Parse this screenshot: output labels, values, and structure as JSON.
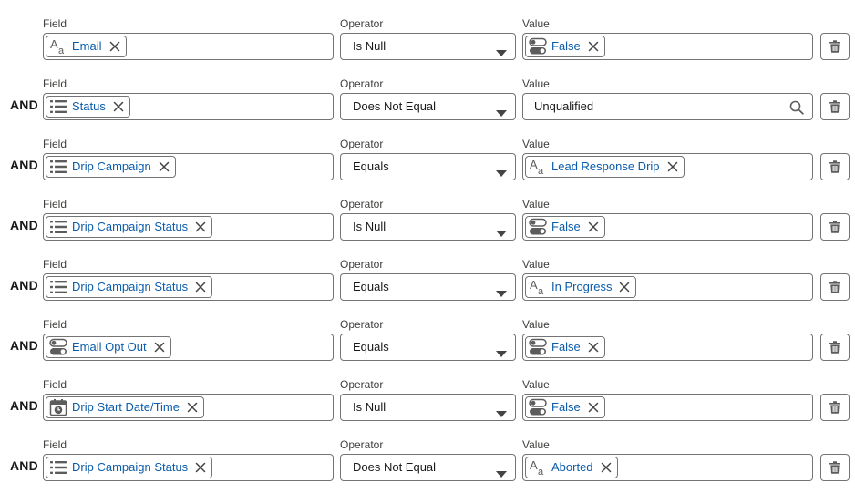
{
  "labels": {
    "field": "Field",
    "operator": "Operator",
    "value": "Value"
  },
  "colors": {
    "pill_text": "#0b5cab",
    "border": "#747474",
    "icon": "#5c5c5c"
  },
  "rows": [
    {
      "conjunction": "",
      "field": {
        "label": "Email",
        "icon": "text-type-icon"
      },
      "operator": "Is Null",
      "value": {
        "kind": "pill",
        "label": "False",
        "icon": "toggle-icon"
      }
    },
    {
      "conjunction": "AND",
      "field": {
        "label": "Status",
        "icon": "picklist-icon"
      },
      "operator": "Does Not Equal",
      "value": {
        "kind": "search",
        "label": "Unqualified",
        "icon": "search-icon"
      }
    },
    {
      "conjunction": "AND",
      "field": {
        "label": "Drip Campaign",
        "icon": "picklist-icon"
      },
      "operator": "Equals",
      "value": {
        "kind": "pill",
        "label": "Lead Response Drip",
        "icon": "text-type-icon"
      }
    },
    {
      "conjunction": "AND",
      "field": {
        "label": "Drip Campaign Status",
        "icon": "picklist-icon"
      },
      "operator": "Is Null",
      "value": {
        "kind": "pill",
        "label": "False",
        "icon": "toggle-icon"
      }
    },
    {
      "conjunction": "AND",
      "field": {
        "label": "Drip Campaign Status",
        "icon": "picklist-icon"
      },
      "operator": "Equals",
      "value": {
        "kind": "pill",
        "label": "In Progress",
        "icon": "text-type-icon"
      }
    },
    {
      "conjunction": "AND",
      "field": {
        "label": "Email Opt Out",
        "icon": "toggle-icon"
      },
      "operator": "Equals",
      "value": {
        "kind": "pill",
        "label": "False",
        "icon": "toggle-icon"
      }
    },
    {
      "conjunction": "AND",
      "field": {
        "label": "Drip Start Date/Time",
        "icon": "calendar-clock-icon"
      },
      "operator": "Is Null",
      "value": {
        "kind": "pill",
        "label": "False",
        "icon": "toggle-icon"
      }
    },
    {
      "conjunction": "AND",
      "field": {
        "label": "Drip Campaign Status",
        "icon": "picklist-icon"
      },
      "operator": "Does Not Equal",
      "value": {
        "kind": "pill",
        "label": "Aborted",
        "icon": "text-type-icon"
      }
    }
  ]
}
